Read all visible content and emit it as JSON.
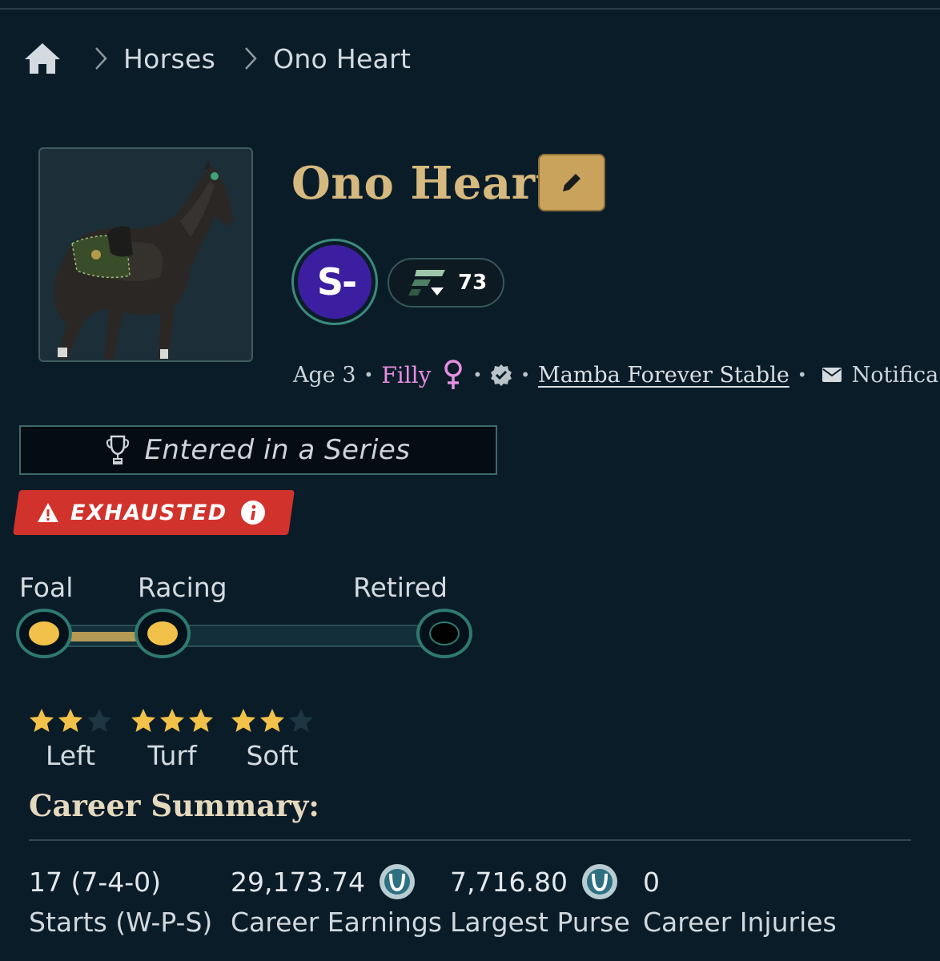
{
  "breadcrumb": {
    "items": [
      "Horses",
      "Ono Heart"
    ]
  },
  "horse": {
    "name": "Ono Heart",
    "grade": "S-",
    "rating": "73",
    "age": "Age 3",
    "sex": "Filly",
    "stable": "Mamba Forever Stable",
    "notifications_label": "Notifica"
  },
  "status": {
    "series": "Entered in a Series",
    "condition": "EXHAUSTED"
  },
  "lifecycle": {
    "stages": [
      "Foal",
      "Racing",
      "Retired"
    ],
    "current_stage": "Racing"
  },
  "preferences": [
    {
      "label": "Left",
      "stars": 2,
      "max": 3
    },
    {
      "label": "Turf",
      "stars": 3,
      "max": 3
    },
    {
      "label": "Soft",
      "stars": 2,
      "max": 3
    }
  ],
  "career": {
    "title": "Career Summary:",
    "stats": [
      {
        "value": "17 (7-4-0)",
        "label": "Starts (W-P-S)",
        "coin": false
      },
      {
        "value": "29,173.74",
        "label": "Career Earnings",
        "coin": true
      },
      {
        "value": "7,716.80",
        "label": "Largest Purse",
        "coin": true
      },
      {
        "value": "0",
        "label": "Career Injuries",
        "coin": false
      }
    ]
  },
  "colors": {
    "background": "#0b1c29",
    "accent_gold": "#d6b97e",
    "grade_purple": "#3b1fa0",
    "exhausted_red": "#d2322c",
    "filly_pink": "#e58fe0",
    "stage_active": "#f2c14a"
  },
  "icons": {
    "home": "home-icon",
    "edit": "pencil-icon",
    "trophy": "trophy-icon",
    "warning": "warning-icon",
    "info": "info-icon",
    "mail": "mail-icon",
    "verified": "verified-icon",
    "coin": "coin-icon"
  }
}
